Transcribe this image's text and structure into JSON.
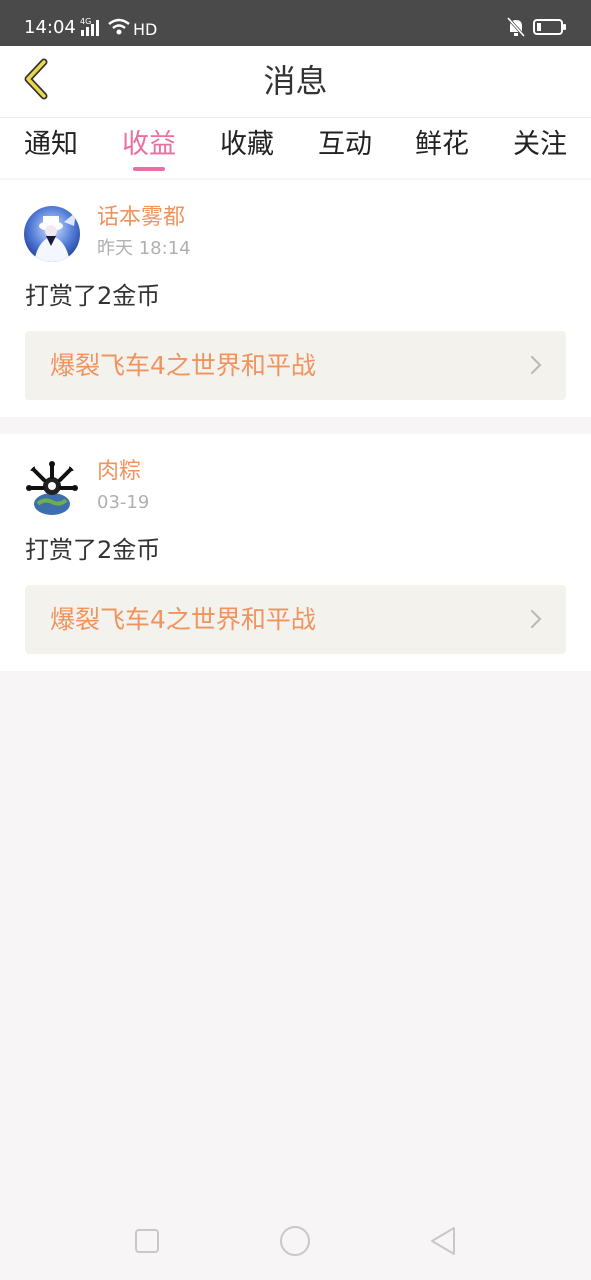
{
  "status_bar": {
    "time": "14:04",
    "network": "4G",
    "hd": "HD",
    "icons": [
      "signal-icon",
      "wifi-icon",
      "mute-icon",
      "battery-icon"
    ]
  },
  "header": {
    "title": "消息",
    "back_icon": "back-arrow-icon",
    "accent_color": "#e9d84a"
  },
  "tabs": [
    {
      "label": "通知",
      "active": false
    },
    {
      "label": "收益",
      "active": true
    },
    {
      "label": "收藏",
      "active": false
    },
    {
      "label": "互动",
      "active": false
    },
    {
      "label": "鲜花",
      "active": false
    },
    {
      "label": "关注",
      "active": false
    }
  ],
  "messages": [
    {
      "username": "话本雾都",
      "time": "昨天 18:14",
      "text": "打赏了2金币",
      "book_title": "爆裂飞车4之世界和平战"
    },
    {
      "username": "肉粽",
      "time": "03-19",
      "text": "打赏了2金币",
      "book_title": "爆裂飞车4之世界和平战"
    }
  ],
  "colors": {
    "tab_active": "#ea6fa2",
    "username": "#f0945f",
    "book_title": "#f0945f",
    "status_bar": "#4a4a4a"
  },
  "system_nav": [
    "recent-apps-icon",
    "home-icon",
    "back-icon"
  ]
}
